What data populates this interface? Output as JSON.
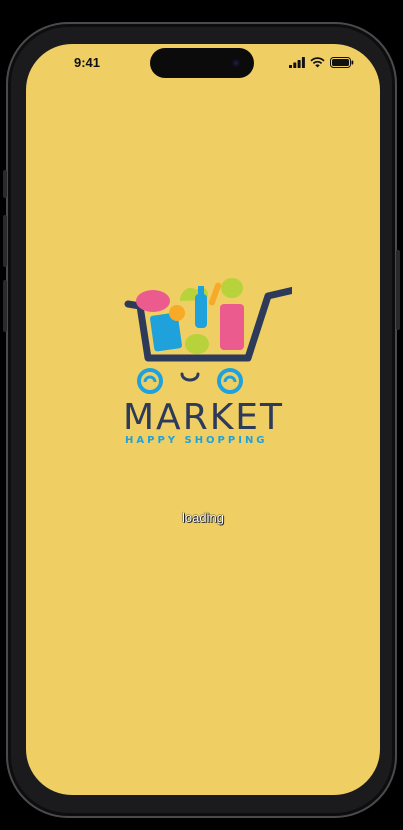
{
  "status_bar": {
    "time": "9:41",
    "icons": [
      "cellular-signal-icon",
      "wifi-icon",
      "battery-icon"
    ]
  },
  "logo": {
    "brand_name": "MARKET",
    "tagline": "HAPPY SHOPPING",
    "colors": {
      "navy": "#2E3A59",
      "blue": "#1FA2DB",
      "pink": "#EC5B8E",
      "green": "#B7D23A",
      "orange": "#F7A928"
    }
  },
  "loading_text": "loading",
  "colors": {
    "background": "#EFCF64",
    "frame": "#1b1b1d"
  }
}
